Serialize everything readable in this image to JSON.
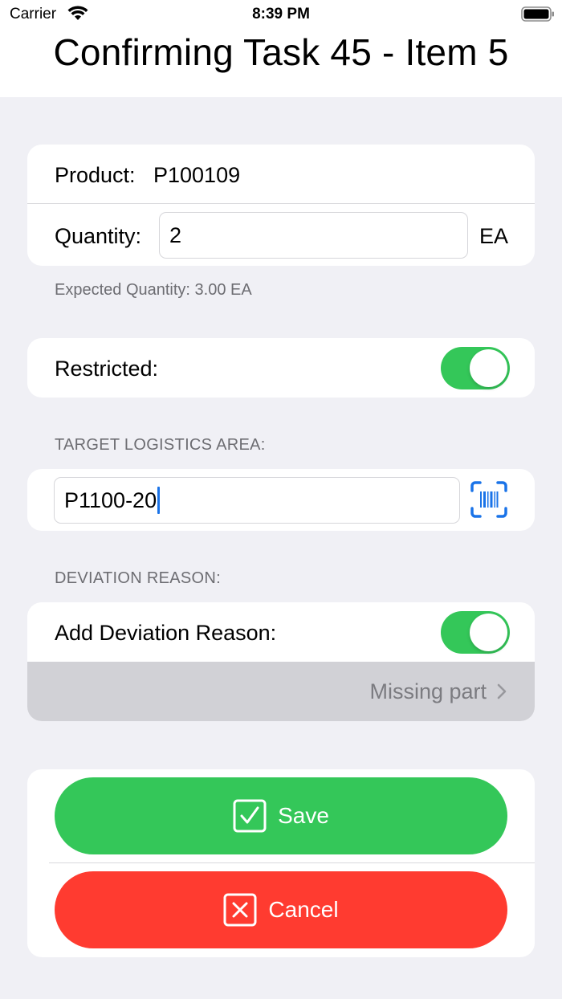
{
  "status_bar": {
    "carrier": "Carrier",
    "time": "8:39 PM"
  },
  "header": {
    "title": "Confirming Task 45 - Item 5"
  },
  "product_card": {
    "product_label": "Product:",
    "product_value": "P100109",
    "quantity_label": "Quantity:",
    "quantity_value": "2",
    "quantity_unit": "EA"
  },
  "expected_quantity": "Expected Quantity: 3.00 EA",
  "restricted": {
    "label": "Restricted:",
    "on": true
  },
  "target_area": {
    "section_label": "TARGET LOGISTICS AREA:",
    "value": "P1100-20"
  },
  "deviation": {
    "section_label": "DEVIATION REASON:",
    "toggle_label": "Add Deviation Reason:",
    "toggle_on": true,
    "reason_value": "Missing part"
  },
  "actions": {
    "save_label": "Save",
    "cancel_label": "Cancel"
  },
  "colors": {
    "accent_green": "#34c759",
    "accent_red": "#ff3b30",
    "accent_blue": "#1a73e8",
    "background": "#f0f0f5"
  },
  "icons": [
    "wifi-icon",
    "battery-icon",
    "barcode-scan-icon",
    "chevron-right-icon",
    "checkbox-check-icon",
    "checkbox-x-icon"
  ]
}
